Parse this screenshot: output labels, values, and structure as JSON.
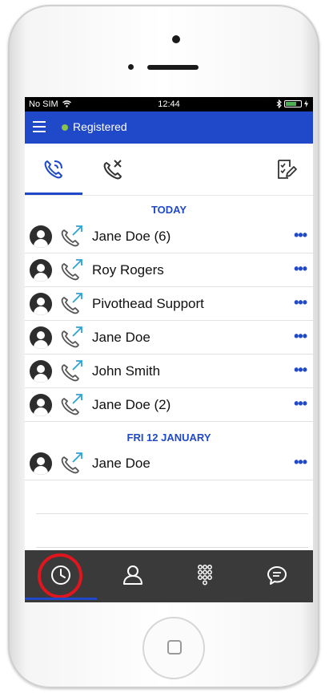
{
  "status_bar": {
    "carrier": "No SIM",
    "time": "12:44"
  },
  "header": {
    "registration_status": "Registered"
  },
  "sections": [
    {
      "date_label": "TODAY",
      "calls": [
        {
          "name": "Jane Doe (6)"
        },
        {
          "name": "Roy Rogers"
        },
        {
          "name": "Pivothead Support"
        },
        {
          "name": "Jane Doe"
        },
        {
          "name": "John Smith"
        },
        {
          "name": "Jane Doe (2)"
        }
      ]
    },
    {
      "date_label": "FRI 12 JANUARY",
      "calls": [
        {
          "name": "Jane Doe"
        }
      ]
    }
  ],
  "more_label": "•••",
  "colors": {
    "accent": "#1f49c8",
    "nav_bg": "#3a3a3a",
    "registered_dot": "#8bc34a",
    "highlight": "#e0161e"
  }
}
